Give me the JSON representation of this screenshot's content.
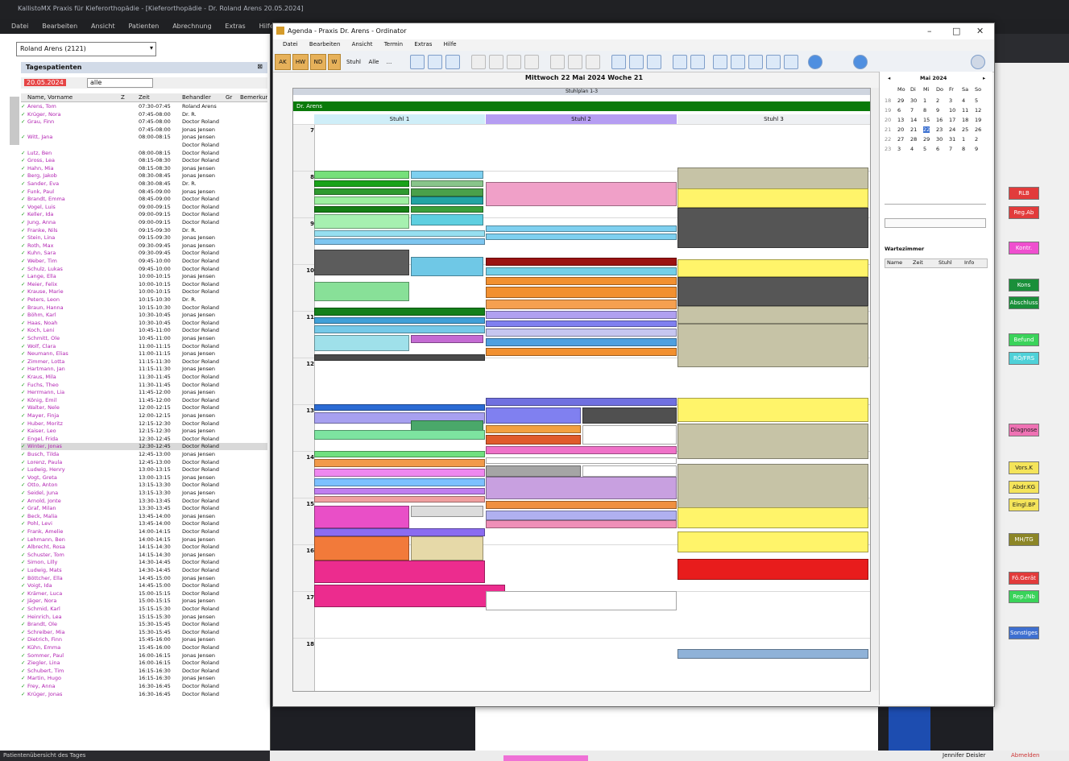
{
  "app": {
    "title": "KallistoMX  Praxis für Kieferorthopädie - [Kieferorthopädie - Dr. Roland Arens 20.05.2024]",
    "menu": [
      "Datei",
      "Bearbeiten",
      "Ansicht",
      "Patienten",
      "Abrechnung",
      "Extras",
      "Hilfe"
    ],
    "doctor_select": "Roland Arens (2121)",
    "patients_header": "Tagespatienten",
    "date_value": "20.05.2024",
    "date_filter": "alle",
    "grid_headers": [
      "Name, Vorname",
      "Z",
      "Zeit",
      "Behandler",
      "Gr",
      "Bemerkung"
    ],
    "left_status": "Patientenübersicht des Tages",
    "main_status_right": "Jennifer Deisler",
    "main_status_logout": "Abmelden"
  },
  "patients": [
    {
      "name": "Arens, Tom",
      "time": "07:30-07:45",
      "who": "Roland Arens",
      "done": true
    },
    {
      "name": "Krüger, Nora",
      "time": "07:45-08:00",
      "who": "Dr. R.",
      "done": true
    },
    {
      "name": "Grau, Finn",
      "time": "07:45-08:00",
      "who": "Doctor Roland",
      "done": true
    },
    {
      "name": "",
      "time": "07:45-08:00",
      "who": "Jonas Jensen",
      "done": false
    },
    {
      "name": "Witt, Jana",
      "time": "08:00-08:15",
      "who": "Jonas Jensen",
      "done": true
    },
    {
      "name": "",
      "time": "",
      "who": "Doctor Roland",
      "done": false
    },
    {
      "name": "Lutz, Ben",
      "time": "08:00-08:15",
      "who": "Doctor Roland",
      "done": true
    },
    {
      "name": "Gross, Lea",
      "time": "08:15-08:30",
      "who": "Doctor Roland",
      "done": true
    },
    {
      "name": "Hahn, Mia",
      "time": "08:15-08:30",
      "who": "Jonas Jensen",
      "done": true
    },
    {
      "name": "Berg, Jakob",
      "time": "08:30-08:45",
      "who": "Jonas Jensen",
      "done": true
    },
    {
      "name": "Sander, Eva",
      "time": "08:30-08:45",
      "who": "Dr. R.",
      "done": true
    },
    {
      "name": "Funk, Paul",
      "time": "08:45-09:00",
      "who": "Jonas Jensen",
      "done": true
    },
    {
      "name": "Brandt, Emma",
      "time": "08:45-09:00",
      "who": "Doctor Roland",
      "done": true
    },
    {
      "name": "Vogel, Luis",
      "time": "09:00-09:15",
      "who": "Doctor Roland",
      "done": true
    },
    {
      "name": "Keller, Ida",
      "time": "09:00-09:15",
      "who": "Doctor Roland",
      "done": true
    },
    {
      "name": "Jung, Anna",
      "time": "09:00-09:15",
      "who": "Doctor Roland",
      "done": true
    },
    {
      "name": "Franke, Nils",
      "time": "09:15-09:30",
      "who": "Dr. R.",
      "done": true
    },
    {
      "name": "Stein, Lina",
      "time": "09:15-09:30",
      "who": "Jonas Jensen",
      "done": true
    },
    {
      "name": "Roth, Max",
      "time": "09:30-09:45",
      "who": "Jonas Jensen",
      "done": true
    },
    {
      "name": "Kuhn, Sara",
      "time": "09:30-09:45",
      "who": "Doctor Roland",
      "done": true
    },
    {
      "name": "Weber, Tim",
      "time": "09:45-10:00",
      "who": "Doctor Roland",
      "done": true
    },
    {
      "name": "Schulz, Lukas",
      "time": "09:45-10:00",
      "who": "Doctor Roland",
      "done": true
    },
    {
      "name": "Lange, Ella",
      "time": "10:00-10:15",
      "who": "Jonas Jensen",
      "done": true
    },
    {
      "name": "Meier, Felix",
      "time": "10:00-10:15",
      "who": "Doctor Roland",
      "done": true
    },
    {
      "name": "Krause, Marie",
      "time": "10:00-10:15",
      "who": "Doctor Roland",
      "done": true
    },
    {
      "name": "Peters, Leon",
      "time": "10:15-10:30",
      "who": "Dr. R.",
      "done": true
    },
    {
      "name": "Braun, Hanna",
      "time": "10:15-10:30",
      "who": "Doctor Roland",
      "done": true
    },
    {
      "name": "Böhm, Karl",
      "time": "10:30-10:45",
      "who": "Jonas Jensen",
      "done": true
    },
    {
      "name": "Haas, Noah",
      "time": "10:30-10:45",
      "who": "Doctor Roland",
      "done": true
    },
    {
      "name": "Koch, Leni",
      "time": "10:45-11:00",
      "who": "Doctor Roland",
      "done": true
    },
    {
      "name": "Schmitt, Ole",
      "time": "10:45-11:00",
      "who": "Jonas Jensen",
      "done": true
    },
    {
      "name": "Wolf, Clara",
      "time": "11:00-11:15",
      "who": "Doctor Roland",
      "done": true
    },
    {
      "name": "Neumann, Elias",
      "time": "11:00-11:15",
      "who": "Jonas Jensen",
      "done": true
    },
    {
      "name": "Zimmer, Lotta",
      "time": "11:15-11:30",
      "who": "Doctor Roland",
      "done": true
    },
    {
      "name": "Hartmann, Jan",
      "time": "11:15-11:30",
      "who": "Jonas Jensen",
      "done": true
    },
    {
      "name": "Kraus, Mila",
      "time": "11:30-11:45",
      "who": "Doctor Roland",
      "done": true
    },
    {
      "name": "Fuchs, Theo",
      "time": "11:30-11:45",
      "who": "Doctor Roland",
      "done": true
    },
    {
      "name": "Herrmann, Lia",
      "time": "11:45-12:00",
      "who": "Jonas Jensen",
      "done": true
    },
    {
      "name": "König, Emil",
      "time": "11:45-12:00",
      "who": "Doctor Roland",
      "done": true
    },
    {
      "name": "Walter, Nele",
      "time": "12:00-12:15",
      "who": "Doctor Roland",
      "done": true
    },
    {
      "name": "Mayer, Finja",
      "time": "12:00-12:15",
      "who": "Jonas Jensen",
      "done": true
    },
    {
      "name": "Huber, Moritz",
      "time": "12:15-12:30",
      "who": "Doctor Roland",
      "done": true
    },
    {
      "name": "Kaiser, Leo",
      "time": "12:15-12:30",
      "who": "Jonas Jensen",
      "done": true
    },
    {
      "name": "Engel, Frida",
      "time": "12:30-12:45",
      "who": "Doctor Roland",
      "done": true
    },
    {
      "name": "Winter, Jonas",
      "time": "12:30-12:45",
      "who": "Doctor Roland",
      "done": true
    },
    {
      "name": "Busch, Tilda",
      "time": "12:45-13:00",
      "who": "Jonas Jensen",
      "done": true
    },
    {
      "name": "Lorenz, Paula",
      "time": "12:45-13:00",
      "who": "Doctor Roland",
      "done": true
    },
    {
      "name": "Ludwig, Henry",
      "time": "13:00-13:15",
      "who": "Doctor Roland",
      "done": true
    },
    {
      "name": "Vogt, Greta",
      "time": "13:00-13:15",
      "who": "Jonas Jensen",
      "done": true
    },
    {
      "name": "Otto, Anton",
      "time": "13:15-13:30",
      "who": "Doctor Roland",
      "done": true
    },
    {
      "name": "Seidel, Juna",
      "time": "13:15-13:30",
      "who": "Jonas Jensen",
      "done": true
    },
    {
      "name": "Arnold, Jonte",
      "time": "13:30-13:45",
      "who": "Doctor Roland",
      "done": true
    },
    {
      "name": "Graf, Milan",
      "time": "13:30-13:45",
      "who": "Doctor Roland",
      "done": true
    },
    {
      "name": "Beck, Malia",
      "time": "13:45-14:00",
      "who": "Jonas Jensen",
      "done": true
    },
    {
      "name": "Pohl, Levi",
      "time": "13:45-14:00",
      "who": "Doctor Roland",
      "done": true
    },
    {
      "name": "Frank, Amelie",
      "time": "14:00-14:15",
      "who": "Doctor Roland",
      "done": true
    },
    {
      "name": "Lehmann, Ben",
      "time": "14:00-14:15",
      "who": "Jonas Jensen",
      "done": true
    },
    {
      "name": "Albrecht, Rosa",
      "time": "14:15-14:30",
      "who": "Doctor Roland",
      "done": true
    },
    {
      "name": "Schuster, Tom",
      "time": "14:15-14:30",
      "who": "Jonas Jensen",
      "done": true
    },
    {
      "name": "Simon, Lilly",
      "time": "14:30-14:45",
      "who": "Doctor Roland",
      "done": true
    },
    {
      "name": "Ludwig, Mats",
      "time": "14:30-14:45",
      "who": "Doctor Roland",
      "done": true
    },
    {
      "name": "Böttcher, Ella",
      "time": "14:45-15:00",
      "who": "Jonas Jensen",
      "done": true
    },
    {
      "name": "Voigt, Ida",
      "time": "14:45-15:00",
      "who": "Doctor Roland",
      "done": true
    },
    {
      "name": "Krämer, Luca",
      "time": "15:00-15:15",
      "who": "Doctor Roland",
      "done": true
    },
    {
      "name": "Jäger, Nora",
      "time": "15:00-15:15",
      "who": "Jonas Jensen",
      "done": true
    },
    {
      "name": "Schmid, Karl",
      "time": "15:15-15:30",
      "who": "Doctor Roland",
      "done": true
    },
    {
      "name": "Heinrich, Lea",
      "time": "15:15-15:30",
      "who": "Jonas Jensen",
      "done": true
    },
    {
      "name": "Brandt, Ole",
      "time": "15:30-15:45",
      "who": "Doctor Roland",
      "done": true
    },
    {
      "name": "Schreiber, Mia",
      "time": "15:30-15:45",
      "who": "Doctor Roland",
      "done": true
    },
    {
      "name": "Dietrich, Finn",
      "time": "15:45-16:00",
      "who": "Jonas Jensen",
      "done": true
    },
    {
      "name": "Kühn, Emma",
      "time": "15:45-16:00",
      "who": "Doctor Roland",
      "done": true
    },
    {
      "name": "Sommer, Paul",
      "time": "16:00-16:15",
      "who": "Jonas Jensen",
      "done": true
    },
    {
      "name": "Ziegler, Lina",
      "time": "16:00-16:15",
      "who": "Doctor Roland",
      "done": true
    },
    {
      "name": "Schubert, Tim",
      "time": "16:15-16:30",
      "who": "Doctor Roland",
      "done": true
    },
    {
      "name": "Martin, Hugo",
      "time": "16:15-16:30",
      "who": "Jonas Jensen",
      "done": true
    },
    {
      "name": "Frey, Anna",
      "time": "16:30-16:45",
      "who": "Doctor Roland",
      "done": true
    },
    {
      "name": "Krüger, Jonas",
      "time": "16:30-16:45",
      "who": "Doctor Roland",
      "done": true
    }
  ],
  "agenda": {
    "title": "Agenda - Praxis Dr. Arens - Ordinator",
    "menu": [
      "Datei",
      "Bearbeiten",
      "Ansicht",
      "Termin",
      "Extras",
      "Hilfe"
    ],
    "toolbar_buttons": [
      "AK",
      "HW",
      "ND",
      "W",
      "Stuhl",
      "Alle",
      "..."
    ],
    "date_title": "Mittwoch 22 Mai 2024     Woche 21",
    "subheader": "Stuhlplan 1-3",
    "green_bar": "Dr. Arens",
    "columns": [
      "Stuhl 1",
      "Stuhl 2",
      "Stuhl 3"
    ],
    "hours": [
      "7",
      "8",
      "9",
      "10",
      "11",
      "12",
      "13",
      "14",
      "15",
      "16",
      "17",
      "18"
    ]
  },
  "calendar": {
    "month": "Mai 2024",
    "weekdays": [
      "Mo",
      "Di",
      "Mi",
      "Do",
      "Fr",
      "Sa",
      "So"
    ],
    "weeks": [
      [
        "18",
        "29",
        "30",
        "1",
        "2",
        "3",
        "4",
        "5"
      ],
      [
        "19",
        "6",
        "7",
        "8",
        "9",
        "10",
        "11",
        "12"
      ],
      [
        "20",
        "13",
        "14",
        "15",
        "16",
        "17",
        "18",
        "19"
      ],
      [
        "21",
        "20",
        "21",
        "22",
        "23",
        "24",
        "25",
        "26"
      ],
      [
        "22",
        "27",
        "28",
        "29",
        "30",
        "31",
        "1",
        "2"
      ],
      [
        "23",
        "3",
        "4",
        "5",
        "6",
        "7",
        "8",
        "9"
      ]
    ],
    "list_header": "Wartezimmer",
    "list_cols": [
      "Name",
      "Zeit",
      "Stuhl",
      "Info"
    ]
  },
  "right_buttons": [
    {
      "label": "RLB",
      "color": "#e23b3b"
    },
    {
      "label": "Reg.Ab",
      "color": "#e23b3b"
    },
    {
      "label": "Kontr.",
      "color": "#ef4fcf"
    },
    {
      "label": "Kons",
      "color": "#1a8f3a"
    },
    {
      "label": "Abschluss",
      "color": "#1a8f3a"
    },
    {
      "label": "Befund",
      "color": "#3ad35a"
    },
    {
      "label": "RÖ/FRS",
      "color": "#4fd1d8"
    },
    {
      "label": "Diagnose",
      "color": "#ef72b4"
    },
    {
      "label": "Vors.K",
      "color": "#f4e45a"
    },
    {
      "label": "Abdr.KG",
      "color": "#f4e45a"
    },
    {
      "label": "Eingl.BP",
      "color": "#f4e45a"
    },
    {
      "label": "MH/TG",
      "color": "#8c8627"
    },
    {
      "label": "Fö.Gerät",
      "color": "#e23b3b"
    },
    {
      "label": "Rep./Nb",
      "color": "#3ad35a"
    },
    {
      "label": "Sonstiges",
      "color": "#3e6fd0"
    }
  ]
}
